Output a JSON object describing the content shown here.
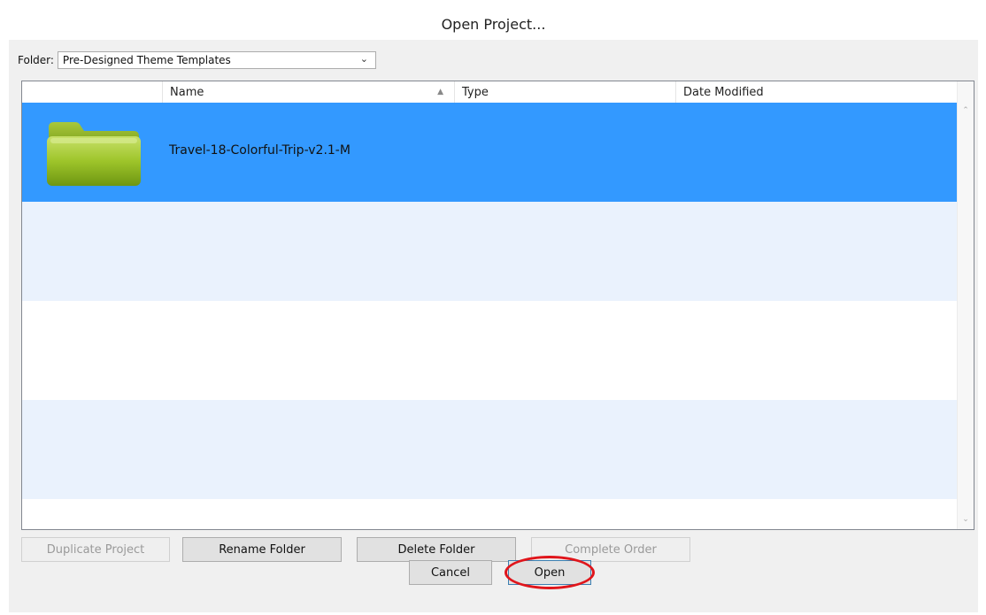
{
  "dialog": {
    "title": "Open Project..."
  },
  "folder": {
    "label": "Folder:",
    "selected": "Pre-Designed Theme Templates"
  },
  "columns": {
    "name": "Name",
    "type": "Type",
    "date": "Date Modified"
  },
  "files": [
    {
      "name": "Travel-18-Colorful-Trip-v2.1-M",
      "selected": true
    }
  ],
  "buttons": {
    "duplicate": "Duplicate Project",
    "rename": "Rename Folder",
    "delete": "Delete Folder",
    "complete": "Complete Order",
    "cancel": "Cancel",
    "open": "Open"
  },
  "colors": {
    "selection": "#3399ff",
    "alt_row": "#eaf2fd",
    "annotation": "#e0151b",
    "folder_green": "#9ec52a"
  }
}
